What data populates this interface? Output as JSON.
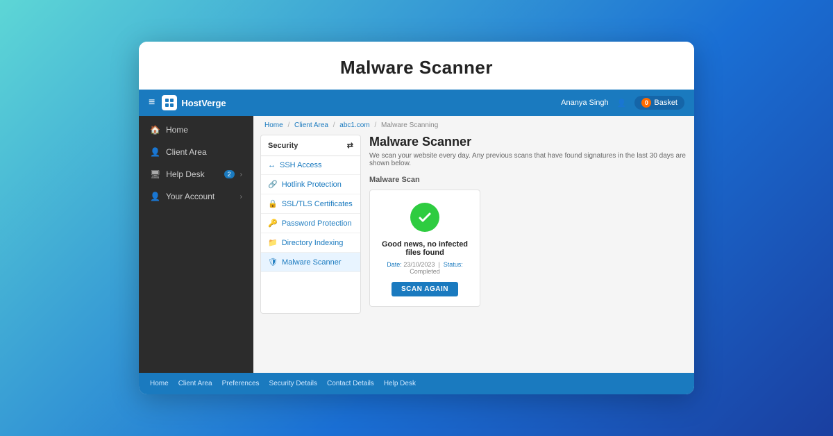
{
  "page": {
    "main_title": "Malware Scanner",
    "outer_bg": "linear-gradient(135deg, #5dd6d6 0%, #1a6fd4 60%, #1a3fa0 100%)"
  },
  "topnav": {
    "hamburger": "≡",
    "brand": "HostVerge",
    "user": "Ananya Singh",
    "basket_label": "Basket",
    "basket_count": "0"
  },
  "sidebar": {
    "items": [
      {
        "label": "Home",
        "icon": "🏠"
      },
      {
        "label": "Client Area",
        "icon": "👤"
      },
      {
        "label": "Help Desk",
        "icon": "🖥",
        "badge": "2"
      },
      {
        "label": "Your Account",
        "icon": "👤"
      }
    ]
  },
  "breadcrumb": {
    "parts": [
      "Home",
      "Client Area",
      "abc1.com",
      "Malware Scanning"
    ]
  },
  "security_panel": {
    "header": "Security",
    "items": [
      {
        "label": "SSH Access",
        "icon": "↔",
        "active": false
      },
      {
        "label": "Hotlink Protection",
        "icon": "🔗",
        "active": false
      },
      {
        "label": "SSL/TLS Certificates",
        "icon": "🔒",
        "active": false
      },
      {
        "label": "Password Protection",
        "icon": "🔑",
        "active": false
      },
      {
        "label": "Directory Indexing",
        "icon": "📁",
        "active": false
      },
      {
        "label": "Malware Scanner",
        "icon": "🛡",
        "active": true
      }
    ]
  },
  "scanner": {
    "title": "Malware Scanner",
    "description": "We scan your website every day. Any previous scans that have found signatures in the last 30 days are shown below.",
    "section_label": "Malware Scan",
    "result_text": "Good news, no infected files found",
    "meta_date_label": "Date:",
    "meta_date_value": "23/10/2023",
    "meta_status_label": "Status:",
    "meta_status_value": "Completed",
    "scan_again_label": "SCAN AGAIN"
  },
  "footer": {
    "links": [
      "Home",
      "Client Area",
      "Preferences",
      "Security Details",
      "Contact Details",
      "Help Desk"
    ]
  }
}
